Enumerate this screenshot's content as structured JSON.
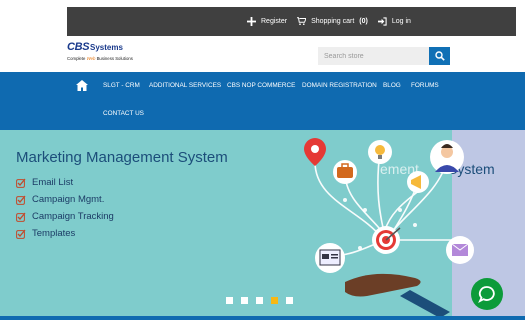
{
  "topbar": {
    "register_label": "Register",
    "cart_label": "Shopping cart",
    "cart_count": "(0)",
    "login_label": "Log in"
  },
  "header": {
    "logo_cbs": "CBS",
    "logo_systems": "Systems",
    "logo_tag_prefix": "Complete",
    "logo_tag_highlight": "Web",
    "logo_tag_suffix": "Business Solutions",
    "search_placeholder": "Search store"
  },
  "nav": {
    "items": [
      "SLGT - CRM",
      "ADDITIONAL SERVICES",
      "CBS NOP COMMERCE",
      "DOMAIN REGISTRATION",
      "BLOG",
      "FORUMS",
      "CONTACT US"
    ]
  },
  "hero": {
    "title": "Marketing Management System",
    "features": [
      "Email List",
      "Campaign Mgmt.",
      "Campaign Tracking",
      "Templates"
    ],
    "ghost_text_a": "ement",
    "ghost_text_b": "System",
    "slide_count": 5,
    "active_slide": 4
  },
  "colors": {
    "nav_blue": "#0f6ab0",
    "hero_teal": "#7fcccc",
    "topbar_dark": "#404040",
    "chat_green": "#0c9b3a",
    "active_dot": "#f7b814"
  }
}
